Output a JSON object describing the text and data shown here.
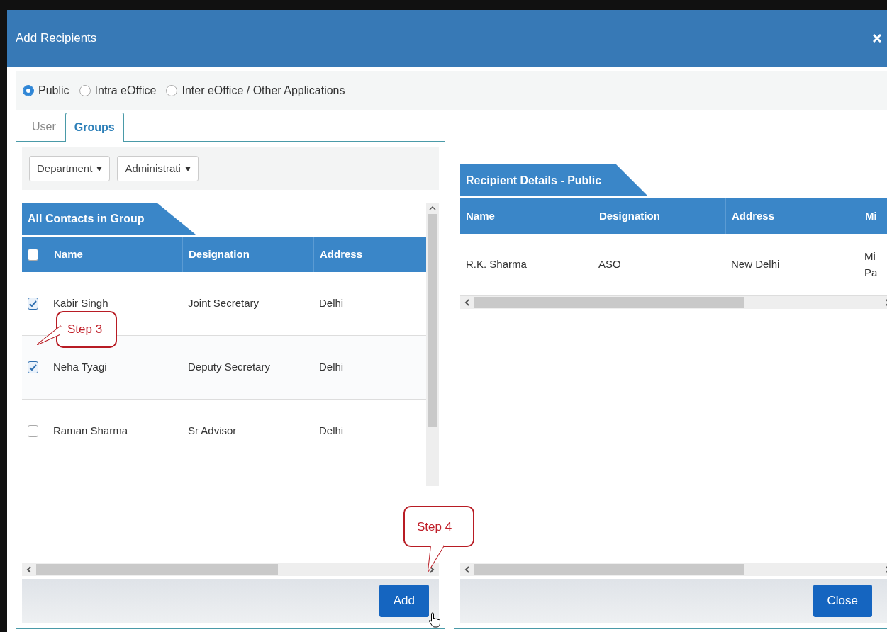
{
  "window": {
    "title": "Add Recipients"
  },
  "recipient_types": [
    {
      "label": "Public",
      "selected": true
    },
    {
      "label": "Intra eOffice",
      "selected": false
    },
    {
      "label": "Inter eOffice / Other Applications",
      "selected": false
    }
  ],
  "tabs": [
    {
      "label": "User",
      "selected": false
    },
    {
      "label": "Groups",
      "selected": true
    }
  ],
  "filters": [
    {
      "value": "Department"
    },
    {
      "value": "Administrati"
    }
  ],
  "contacts": {
    "title": "All Contacts in Group",
    "select_all_checked": false,
    "columns": [
      "Name",
      "Designation",
      "Address"
    ],
    "rows": [
      {
        "checked": true,
        "cells": [
          "Kabir Singh",
          "Joint Secretary",
          "Delhi"
        ]
      },
      {
        "checked": true,
        "cells": [
          "Neha Tyagi",
          "Deputy Secretary",
          "Delhi"
        ]
      },
      {
        "checked": false,
        "cells": [
          "Raman Sharma",
          "Sr Advisor",
          "Delhi"
        ]
      }
    ]
  },
  "add_button": "Add",
  "recipients": {
    "title": "Recipient Details - Public",
    "columns": [
      "Name",
      "Designation",
      "Address",
      "Mi"
    ],
    "rows": [
      {
        "cells": [
          "R.K. Sharma",
          "ASO",
          "New Delhi",
          "Mi\nPa"
        ]
      }
    ]
  },
  "close_button": "Close",
  "callouts": [
    {
      "text": "Step 3"
    },
    {
      "text": "Step 4"
    }
  ]
}
